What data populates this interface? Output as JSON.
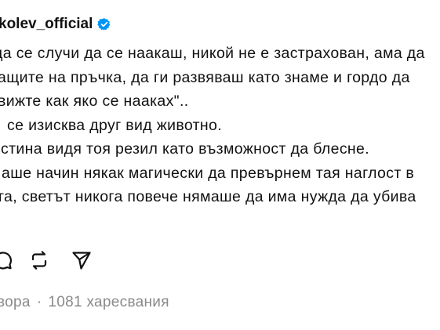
{
  "post": {
    "author": {
      "username": "kolev_official",
      "verified_icon": "verified-badge-icon",
      "badge_color": "#0095f6"
    },
    "lines": [
      "да се случи да се наакаш, никой не е застрахован, ама да",
      "гащите на пръчка, да ги развяваш като знаме и гордо да",
      "вижте как яко се наакаx\".."
    ],
    "lines_rest": [
      "се изисква друг вид животно.",
      "стина видя тоя резил като възможност да блесне.",
      "аше начин някак магически да превърнем тая наглост в",
      "га, светът никога повече нямаше да има нужда да убива"
    ],
    "actions": {
      "comment_icon": "comment-icon",
      "repost_icon": "repost-icon",
      "share_icon": "share-icon"
    },
    "meta": {
      "replies": "вора",
      "separator": "·",
      "likes": "1081 харесвания"
    }
  }
}
